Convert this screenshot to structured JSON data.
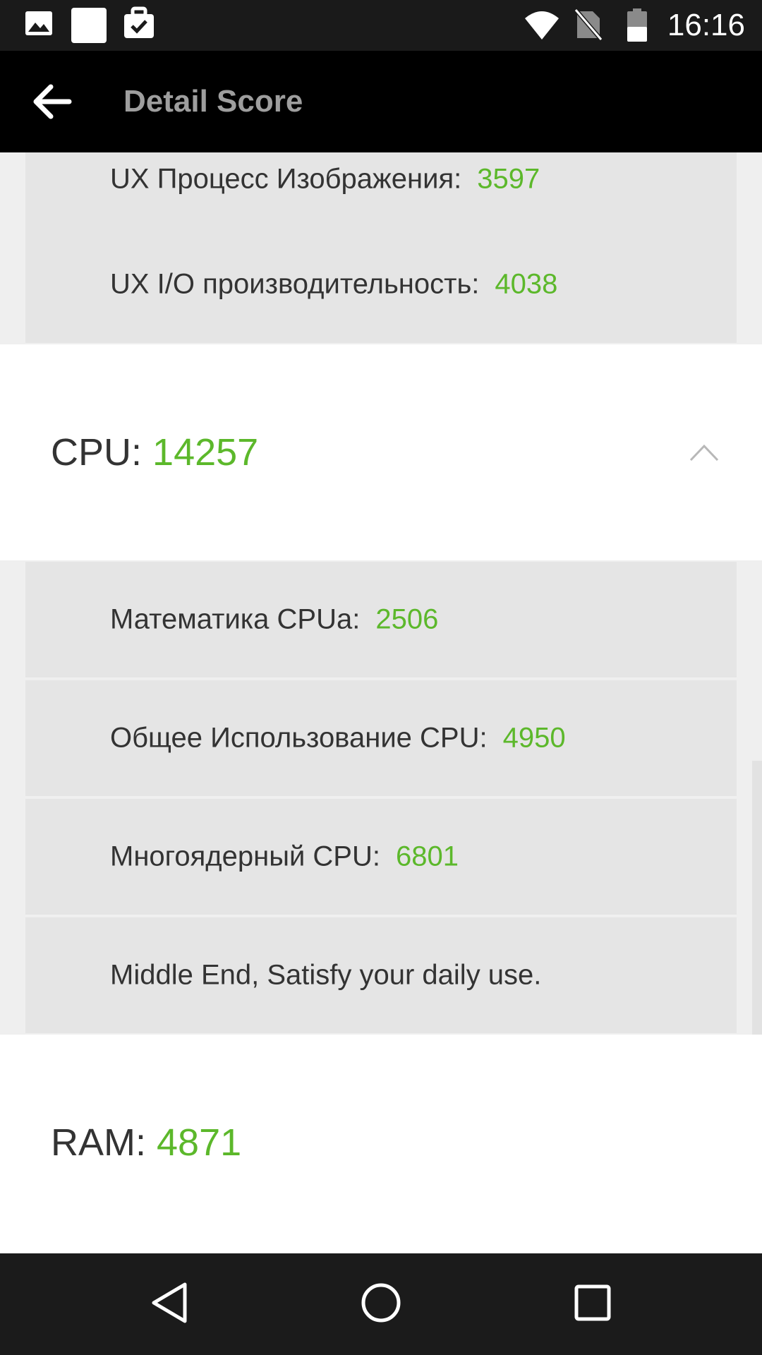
{
  "status_bar": {
    "time": "16:16",
    "icons": [
      "image-icon",
      "blank-notification-icon",
      "briefcase-check-icon",
      "wifi-icon",
      "no-sim-icon",
      "battery-icon"
    ]
  },
  "app_bar": {
    "back_icon": "arrow-left-icon",
    "title": "Detail Score"
  },
  "ux_items": [
    {
      "label": "UX Процесс Изображения:",
      "value": "3597"
    },
    {
      "label": "UX I/O производительность:",
      "value": "4038"
    }
  ],
  "cpu": {
    "label": "CPU:",
    "value": "14257",
    "expanded": true,
    "toggle_icon": "chevron-up-icon",
    "items": [
      {
        "label": "Математика CPUа:",
        "value": "2506"
      },
      {
        "label": "Общее Использование CPU:",
        "value": "4950"
      },
      {
        "label": "Многоядерный CPU:",
        "value": "6801"
      }
    ],
    "note": "Middle End, Satisfy your daily use."
  },
  "ram": {
    "label": "RAM:",
    "value": "4871"
  },
  "colors": {
    "score_green": "#5cb82b",
    "row_gray": "#e5e5e5",
    "text_dark": "#333333"
  },
  "nav_bar": {
    "back_icon": "triangle-back-icon",
    "home_icon": "circle-home-icon",
    "recents_icon": "square-recents-icon"
  }
}
